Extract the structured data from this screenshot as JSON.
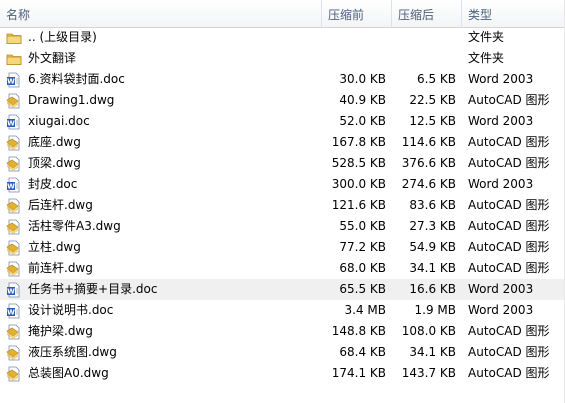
{
  "columns": {
    "name": "名称",
    "before": "压缩前",
    "after": "压缩后",
    "type": "类型"
  },
  "rows": [
    {
      "icon": "folder-up-icon",
      "name": ".. (上级目录)",
      "before": "",
      "after": "",
      "type": "文件夹"
    },
    {
      "icon": "folder-icon",
      "name": "外文翻译",
      "before": "",
      "after": "",
      "type": "文件夹"
    },
    {
      "icon": "word-doc-icon",
      "name": "6.资料袋封面.doc",
      "before": "30.0 KB",
      "after": "6.5 KB",
      "type": "Word 2003"
    },
    {
      "icon": "dwg-file-icon",
      "name": "Drawing1.dwg",
      "before": "40.9 KB",
      "after": "22.5 KB",
      "type": "AutoCAD 图形"
    },
    {
      "icon": "word-doc-icon",
      "name": "xiugai.doc",
      "before": "52.0 KB",
      "after": "12.5 KB",
      "type": "Word 2003"
    },
    {
      "icon": "dwg-file-icon",
      "name": "底座.dwg",
      "before": "167.8 KB",
      "after": "114.6 KB",
      "type": "AutoCAD 图形"
    },
    {
      "icon": "dwg-file-icon",
      "name": "顶梁.dwg",
      "before": "528.5 KB",
      "after": "376.6 KB",
      "type": "AutoCAD 图形"
    },
    {
      "icon": "word-doc-icon",
      "name": "封皮.doc",
      "before": "300.0 KB",
      "after": "274.6 KB",
      "type": "Word 2003"
    },
    {
      "icon": "dwg-file-icon",
      "name": "后连杆.dwg",
      "before": "121.6 KB",
      "after": "83.6 KB",
      "type": "AutoCAD 图形"
    },
    {
      "icon": "dwg-file-icon",
      "name": "活柱零件A3.dwg",
      "before": "55.0 KB",
      "after": "27.3 KB",
      "type": "AutoCAD 图形"
    },
    {
      "icon": "dwg-file-icon",
      "name": "立柱.dwg",
      "before": "77.2 KB",
      "after": "54.9 KB",
      "type": "AutoCAD 图形"
    },
    {
      "icon": "dwg-file-icon",
      "name": "前连杆.dwg",
      "before": "68.0 KB",
      "after": "34.1 KB",
      "type": "AutoCAD 图形"
    },
    {
      "icon": "word-doc-icon",
      "name": "任务书+摘要+目录.doc",
      "before": "65.5 KB",
      "after": "16.6 KB",
      "type": "Word 2003",
      "selected": true
    },
    {
      "icon": "word-doc-icon",
      "name": "设计说明书.doc",
      "before": "3.4 MB",
      "after": "1.9 MB",
      "type": "Word 2003"
    },
    {
      "icon": "dwg-file-icon",
      "name": "掩护梁.dwg",
      "before": "148.8 KB",
      "after": "108.0 KB",
      "type": "AutoCAD 图形"
    },
    {
      "icon": "dwg-file-icon",
      "name": "液压系统图.dwg",
      "before": "68.4 KB",
      "after": "34.1 KB",
      "type": "AutoCAD 图形"
    },
    {
      "icon": "dwg-file-icon",
      "name": "总装图A0.dwg",
      "before": "174.1 KB",
      "after": "143.7 KB",
      "type": "AutoCAD 图形"
    }
  ],
  "colors": {
    "folder": "#e8c15a",
    "word": "#2b5fb4",
    "dwg": "#d9a520",
    "header_text": "#4c607a",
    "selected_row": "#f0f0f0"
  }
}
